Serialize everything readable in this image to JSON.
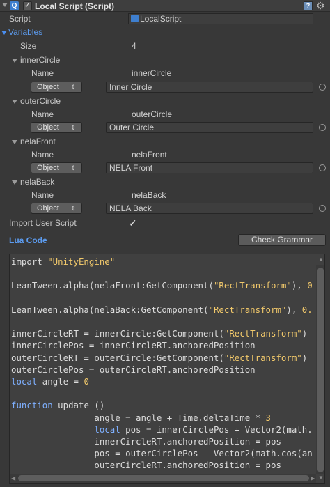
{
  "header": {
    "icon_letter": "Q",
    "check": "✓",
    "title": "Local Script (Script)",
    "help_glyph": "?",
    "gear_glyph": "⚙"
  },
  "script_row": {
    "label": "Script",
    "value": "LocalScript"
  },
  "variables": {
    "label": "Variables",
    "size_label": "Size",
    "size_value": "4",
    "name_label": "Name",
    "type_value": "Object",
    "type_arrows": "⇕",
    "items": [
      {
        "header": "innerCircle",
        "name": "innerCircle",
        "object": "Inner Circle"
      },
      {
        "header": "outerCircle",
        "name": "outerCircle",
        "object": "Outer Circle"
      },
      {
        "header": "nelaFront",
        "name": "nelaFront",
        "object": "NELA Front"
      },
      {
        "header": "nelaBack",
        "name": "nelaBack",
        "object": "NELA Back"
      }
    ]
  },
  "import_user_script": {
    "label": "Import User Script",
    "check": "✓"
  },
  "lua_code": {
    "label": "Lua Code",
    "check_grammar_label": "Check Grammar"
  },
  "code": {
    "lines": [
      [
        {
          "t": "import ",
          "c": ""
        },
        {
          "t": "\"UnityEngine\"",
          "c": "str"
        }
      ],
      [],
      [
        {
          "t": "LeanTween.alpha(nelaFront:GetComponent(",
          "c": ""
        },
        {
          "t": "\"RectTransform\"",
          "c": "str"
        },
        {
          "t": "), ",
          "c": ""
        },
        {
          "t": "0",
          "c": "num"
        }
      ],
      [],
      [
        {
          "t": "LeanTween.alpha(nelaBack:GetComponent(",
          "c": ""
        },
        {
          "t": "\"RectTransform\"",
          "c": "str"
        },
        {
          "t": "), ",
          "c": ""
        },
        {
          "t": "0.",
          "c": "num"
        }
      ],
      [],
      [
        {
          "t": "innerCircleRT = innerCircle:GetComponent(",
          "c": ""
        },
        {
          "t": "\"RectTransform\"",
          "c": "str"
        },
        {
          "t": ")",
          "c": ""
        }
      ],
      [
        {
          "t": "innerCirclePos = innerCircleRT.anchoredPosition",
          "c": ""
        }
      ],
      [
        {
          "t": "outerCircleRT = outerCircle:GetComponent(",
          "c": ""
        },
        {
          "t": "\"RectTransform\"",
          "c": "str"
        },
        {
          "t": ")",
          "c": ""
        }
      ],
      [
        {
          "t": "outerCirclePos = outerCircleRT.anchoredPosition",
          "c": ""
        }
      ],
      [
        {
          "t": "local",
          "c": "kw"
        },
        {
          "t": " angle = ",
          "c": ""
        },
        {
          "t": "0",
          "c": "num"
        }
      ],
      [],
      [
        {
          "t": "function",
          "c": "kw"
        },
        {
          "t": " update ()",
          "c": ""
        }
      ],
      [
        {
          "t": "                angle = angle + Time.deltaTime * ",
          "c": ""
        },
        {
          "t": "3",
          "c": "num"
        }
      ],
      [
        {
          "t": "                ",
          "c": ""
        },
        {
          "t": "local",
          "c": "kw"
        },
        {
          "t": " pos = innerCirclePos + Vector2(math.",
          "c": ""
        }
      ],
      [
        {
          "t": "                innerCircleRT.anchoredPosition = pos",
          "c": ""
        }
      ],
      [
        {
          "t": "                pos = outerCirclePos - Vector2(math.cos(an",
          "c": ""
        }
      ],
      [
        {
          "t": "                outerCircleRT.anchoredPosition = pos",
          "c": ""
        }
      ]
    ]
  },
  "scrollbars": {
    "up": "▲",
    "down": "▼",
    "left": "◀",
    "right": "▶"
  }
}
